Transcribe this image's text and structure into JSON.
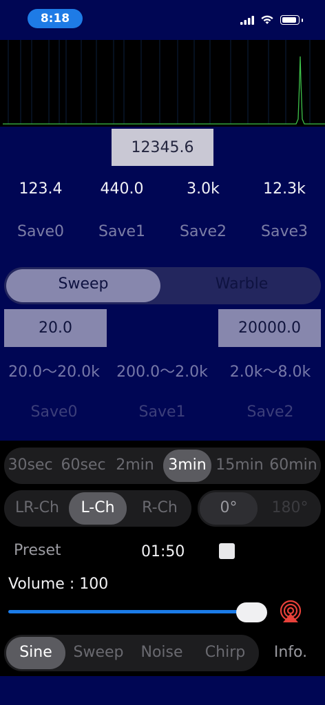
{
  "status_bar": {
    "time": "8:18"
  },
  "display": {
    "frequency": "12345.6"
  },
  "presets": {
    "values": [
      "123.4",
      "440.0",
      "3.0k",
      "12.3k"
    ],
    "save_labels": [
      "Save0",
      "Save1",
      "Save2",
      "Save3"
    ]
  },
  "sweep_mode": {
    "options": [
      "Sweep",
      "Warble"
    ],
    "selected": "Sweep"
  },
  "sweep_range": {
    "start": "20.0",
    "end": "20000.0",
    "ranges": [
      "20.0〜20.0k",
      "200.0〜2.0k",
      "2.0k〜8.0k"
    ],
    "save_labels": [
      "Save0",
      "Save1",
      "Save2"
    ]
  },
  "duration": {
    "options": [
      "30sec",
      "60sec",
      "2min",
      "3min",
      "15min",
      "60min"
    ],
    "selected": "3min"
  },
  "channel": {
    "options": [
      "LR-Ch",
      "L-Ch",
      "R-Ch"
    ],
    "selected": "L-Ch"
  },
  "phase": {
    "options": [
      "0°",
      "180°"
    ],
    "selected": "0°"
  },
  "timer": {
    "preset_label": "Preset",
    "elapsed": "01:50"
  },
  "volume": {
    "label": "Volume : 100",
    "level": 100
  },
  "waveform": {
    "options": [
      "Sine",
      "Sweep",
      "Noise",
      "Chirp"
    ],
    "selected": "Sine"
  },
  "info_label": "Info.",
  "colors": {
    "background": "#000654",
    "accent": "#1b7be8",
    "spectrum_line": "#3ec24a",
    "airplay": "#e8413a"
  }
}
